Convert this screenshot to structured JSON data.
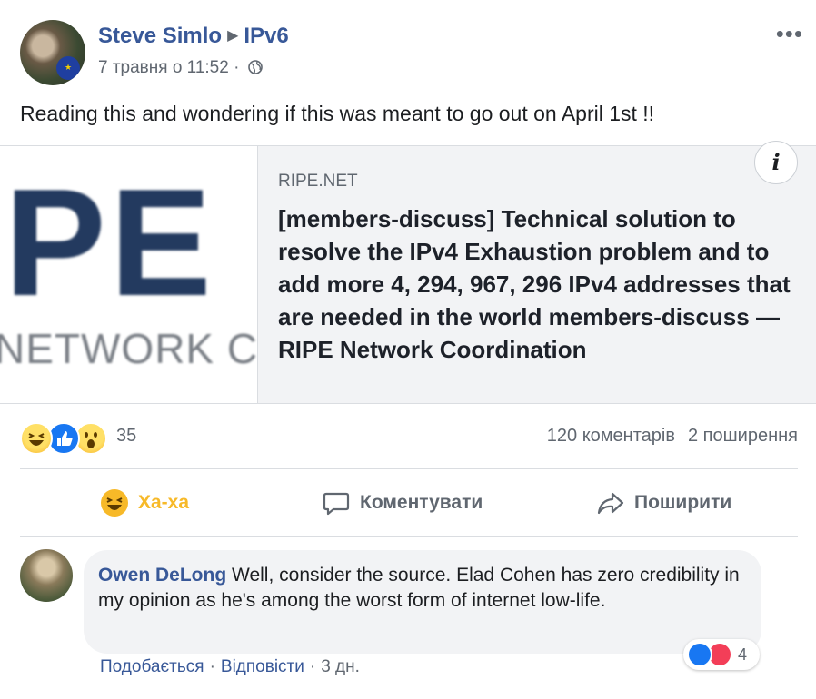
{
  "post": {
    "author": "Steve Simlo",
    "group": "IPv6",
    "date": "7 травня о 11:52",
    "audience_icon": "globe-icon",
    "text": "Reading this and wondering if this was meant to go out on April 1st !!"
  },
  "link_card": {
    "image_text_large": "IPE",
    "image_text_small": "NETWORK COO",
    "domain": "RIPE.NET",
    "title": "[members-discuss] Technical solution to resolve the IPv4 Exhaustion problem and to add more 4, 294, 967, 296 IPv4 addresses that are needed in the world members-discuss — RIPE Network Coordination",
    "info_label": "i"
  },
  "stats": {
    "reaction_icons": [
      "haha-icon",
      "like-icon",
      "wow-icon"
    ],
    "reaction_count": "35",
    "comments": "120 коментарів",
    "shares": "2 поширення"
  },
  "actions": {
    "haha": "Ха-ха",
    "comment": "Коментувати",
    "share": "Поширити"
  },
  "comment": {
    "author": "Owen DeLong",
    "text": "Well, consider the source. Elad Cohen has zero credibility in my opinion as he's among the worst form of internet low-life.",
    "reaction_icons": [
      "like-icon",
      "love-icon"
    ],
    "reaction_count": "4",
    "like_label": "Подобається",
    "reply_label": "Відповісти",
    "separator": "·",
    "time": "3 дн."
  },
  "colors": {
    "link_blue": "#385898",
    "meta_gray": "#606770",
    "haha_yellow": "#f7b928",
    "like_blue": "#1877f2",
    "love_red": "#f33e58"
  }
}
